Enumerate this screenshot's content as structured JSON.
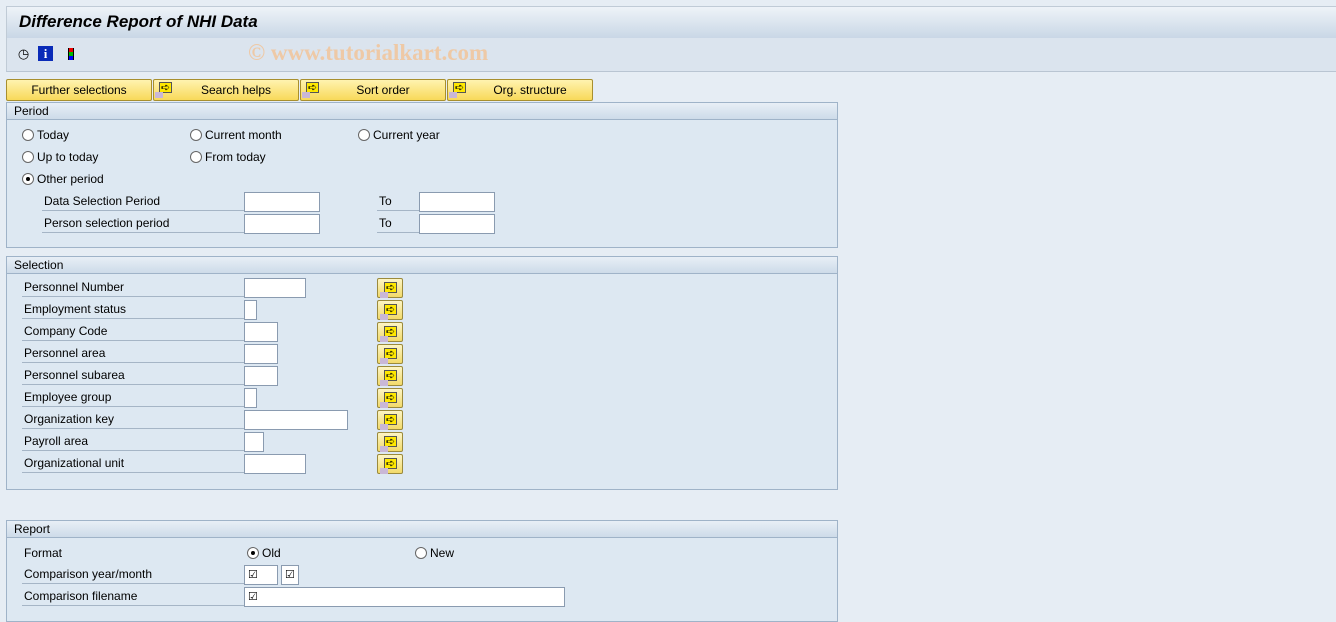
{
  "title": "Difference Report of NHI Data",
  "watermark": "© www.tutorialkart.com",
  "toolbar": {
    "icons": [
      "execute-icon",
      "info-icon",
      "selection-options-icon"
    ]
  },
  "tabs": [
    {
      "label": "Further selections"
    },
    {
      "label": "Search helps"
    },
    {
      "label": "Sort order"
    },
    {
      "label": "Org. structure"
    }
  ],
  "period": {
    "header": "Period",
    "radios": [
      {
        "label": "Today",
        "selected": false
      },
      {
        "label": "Current month",
        "selected": false
      },
      {
        "label": "Current year",
        "selected": false
      },
      {
        "label": "Up to today",
        "selected": false
      },
      {
        "label": "From today",
        "selected": false
      },
      {
        "label": "Other period",
        "selected": true
      }
    ],
    "rows": [
      {
        "label": "Data Selection Period",
        "from": "",
        "to_label": "To",
        "to": ""
      },
      {
        "label": "Person selection period",
        "from": "",
        "to_label": "To",
        "to": ""
      }
    ]
  },
  "selection": {
    "header": "Selection",
    "rows": [
      {
        "label": "Personnel Number",
        "value": ""
      },
      {
        "label": "Employment status",
        "value": ""
      },
      {
        "label": "Company Code",
        "value": ""
      },
      {
        "label": "Personnel area",
        "value": ""
      },
      {
        "label": "Personnel subarea",
        "value": ""
      },
      {
        "label": "Employee group",
        "value": ""
      },
      {
        "label": "Organization key",
        "value": ""
      },
      {
        "label": "Payroll area",
        "value": ""
      },
      {
        "label": "Organizational unit",
        "value": ""
      }
    ]
  },
  "report": {
    "header": "Report",
    "format_label": "Format",
    "format_options": [
      {
        "label": "Old",
        "selected": true
      },
      {
        "label": "New",
        "selected": false
      }
    ],
    "year_month_label": "Comparison year/month",
    "year_value": "☑",
    "month_value": "☑",
    "filename_label": "Comparison filename",
    "filename_value": "☑"
  }
}
